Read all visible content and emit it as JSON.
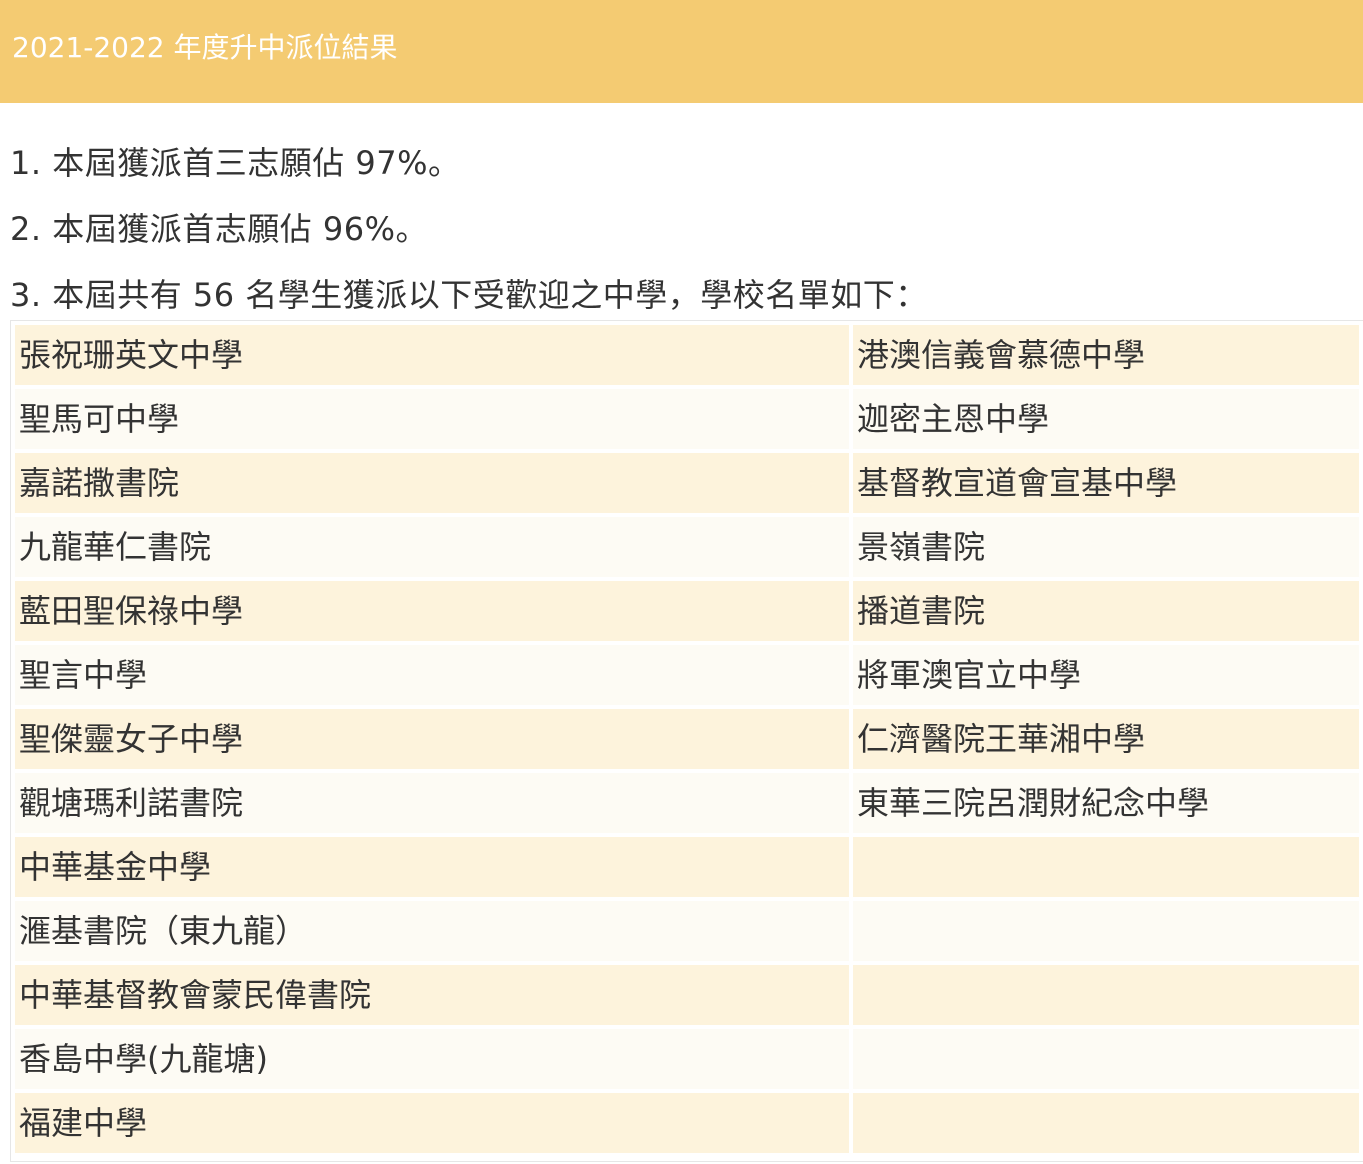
{
  "header": {
    "title": "2021-2022 年度升中派位結果"
  },
  "points": [
    "1. 本屆獲派首三志願佔 97%。",
    "2. 本屆獲派首志願佔 96%。",
    "3. 本屆共有 56 名學生獲派以下受歡迎之中學，學校名單如下："
  ],
  "schools": {
    "rows": [
      [
        "張祝珊英文中學",
        "港澳信義會慕德中學"
      ],
      [
        "聖馬可中學",
        "迦密主恩中學"
      ],
      [
        "嘉諾撒書院",
        "基督教宣道會宣基中學"
      ],
      [
        "九龍華仁書院",
        "景嶺書院"
      ],
      [
        "藍田聖保祿中學",
        "播道書院"
      ],
      [
        "聖言中學",
        "將軍澳官立中學"
      ],
      [
        "聖傑靈女子中學",
        "仁濟醫院王華湘中學"
      ],
      [
        "觀塘瑪利諾書院",
        "東華三院呂潤財紀念中學"
      ],
      [
        "中華基金中學",
        ""
      ],
      [
        "滙基書院（東九龍）",
        ""
      ],
      [
        "中華基督教會蒙民偉書院",
        ""
      ],
      [
        "香島中學(九龍塘)",
        ""
      ],
      [
        "福建中學",
        ""
      ]
    ]
  },
  "colors": {
    "header_bg": "#f4cb72",
    "header_text": "#ffffff",
    "row_odd": "#fdf3dc",
    "row_even": "#fdfbf4",
    "text": "#333333"
  }
}
